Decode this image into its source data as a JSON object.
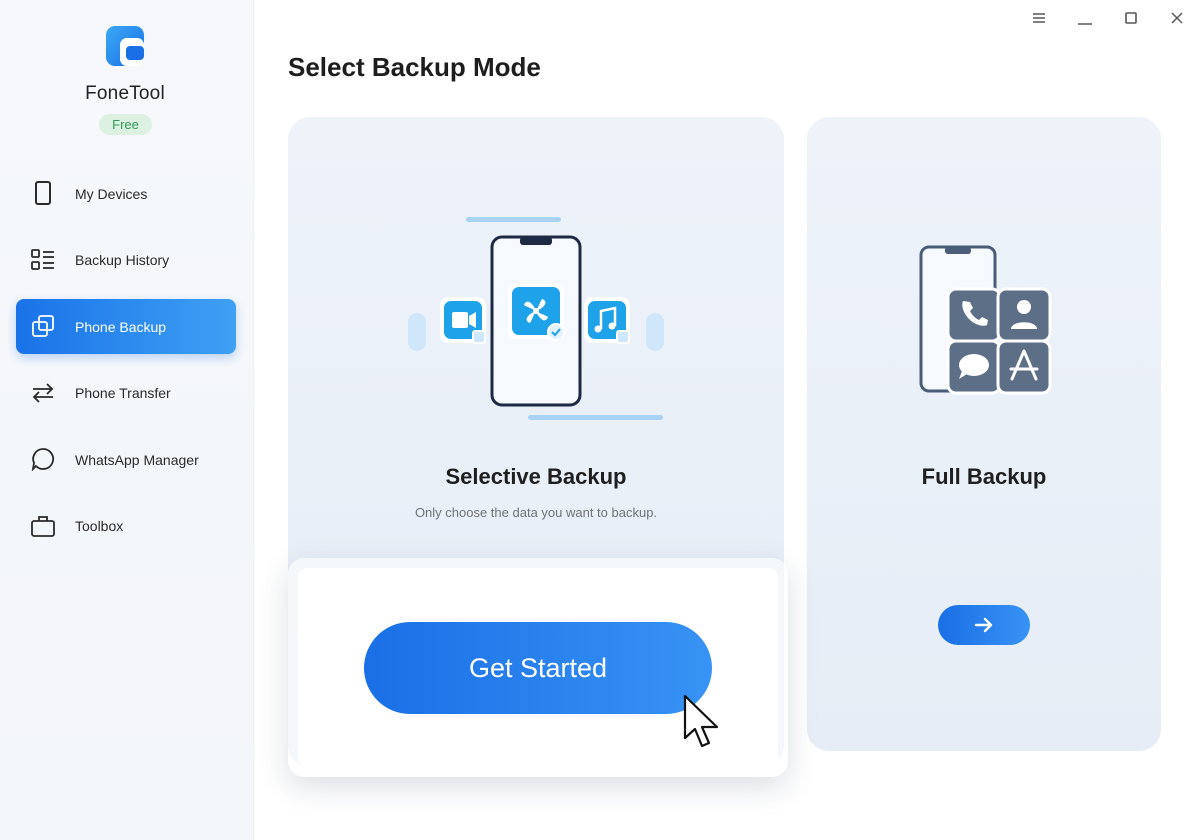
{
  "app": {
    "name": "FoneTool",
    "plan": "Free"
  },
  "sidebar": {
    "items": [
      {
        "label": "My Devices",
        "icon": "phone-icon",
        "active": false
      },
      {
        "label": "Backup History",
        "icon": "list-icon",
        "active": false
      },
      {
        "label": "Phone Backup",
        "icon": "copy-icon",
        "active": true
      },
      {
        "label": "Phone Transfer",
        "icon": "transfer-arrows-icon",
        "active": false
      },
      {
        "label": "WhatsApp Manager",
        "icon": "chat-bubble-icon",
        "active": false
      },
      {
        "label": "Toolbox",
        "icon": "briefcase-icon",
        "active": false
      }
    ]
  },
  "window_controls": [
    "menu-icon",
    "minimize-icon",
    "maximize-icon",
    "close-icon"
  ],
  "main": {
    "title": "Select Backup Mode",
    "modes": {
      "selective": {
        "title": "Selective Backup",
        "description": "Only choose the data you want to backup.",
        "button_label": "Get Started"
      },
      "full": {
        "title": "Full Backup",
        "button_icon": "arrow-right-icon"
      }
    }
  },
  "colors": {
    "accent": "#1a73e8",
    "accent_light": "#3fa0f5",
    "badge_bg": "#dcf1e2",
    "badge_text": "#2f9a57",
    "card_bg": "#eef3fa"
  }
}
